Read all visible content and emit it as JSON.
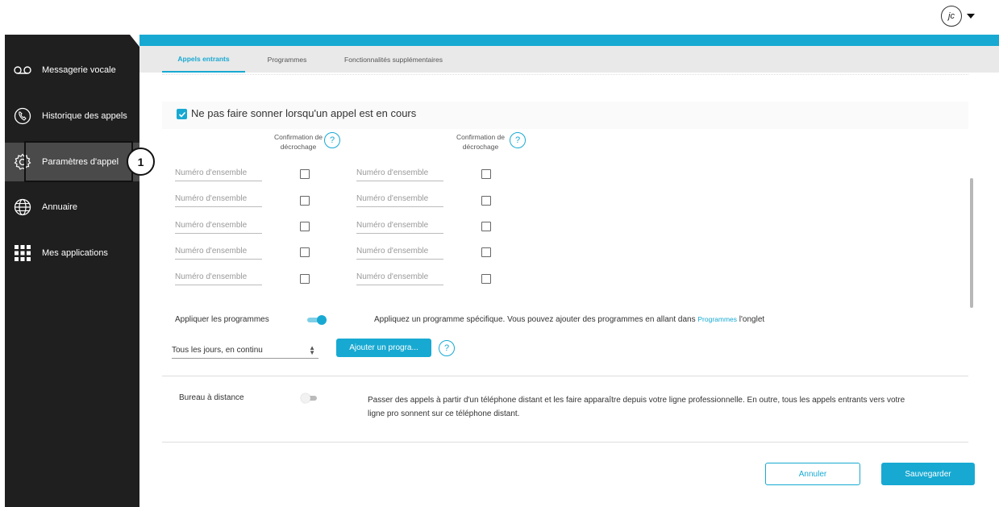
{
  "user": {
    "initials": "jc"
  },
  "sidebar": {
    "items": [
      {
        "label": "Messagerie vocale",
        "icon": "voicemail-icon"
      },
      {
        "label": "Historique des appels",
        "icon": "call-history-icon"
      },
      {
        "label": "Paramètres d'appel",
        "icon": "gear-icon"
      },
      {
        "label": "Annuaire",
        "icon": "globe-icon"
      },
      {
        "label": "Mes applications",
        "icon": "apps-grid-icon"
      }
    ],
    "active_index": 2,
    "marker": "1"
  },
  "tabs": [
    {
      "label": "Appels entrants",
      "active": true
    },
    {
      "label": "Programmes",
      "active": false
    },
    {
      "label": "Fonctionnalités supplémentaires",
      "active": false
    }
  ],
  "no_ring": {
    "label": "Ne pas faire sonner lorsqu'un appel est en cours",
    "checked": true
  },
  "columns": {
    "header": "Confirmation de décrochage",
    "help": "?"
  },
  "rows": {
    "placeholder": "Numéro d'ensemble",
    "count": 5
  },
  "schedule": {
    "label": "Appliquer les programmes",
    "enabled": true,
    "description": "Appliquez un programme spécifique. Vous pouvez ajouter des programmes en allant dans",
    "link_text": "Programmes",
    "suffix": "l'onglet",
    "select_value": "Tous les jours, en continu",
    "add_button": "Ajouter un progra...",
    "help": "?"
  },
  "remote_office": {
    "label": "Bureau à distance",
    "enabled": false,
    "description": "Passer des appels à partir d'un téléphone distant et les faire apparaître depuis votre ligne professionnelle. En outre, tous les appels entrants vers votre ligne pro sonnent sur ce téléphone distant."
  },
  "footer": {
    "cancel": "Annuler",
    "save": "Sauvegarder"
  },
  "colors": {
    "accent": "#17a9d2",
    "sidebar": "#1f1f1f",
    "sidebar_active": "#4a4a4a"
  }
}
